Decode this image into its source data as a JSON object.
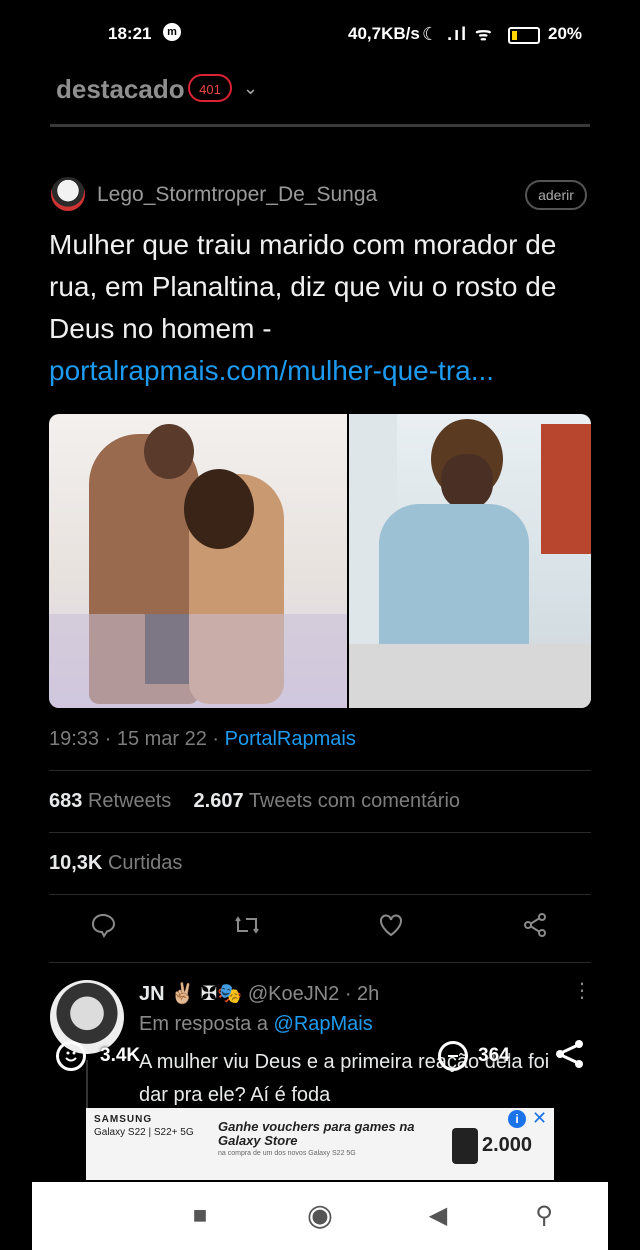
{
  "status_bar": {
    "time": "18:21",
    "net_speed": "40,7KB/s",
    "signal_icons": "☾ .ıl ᯤ",
    "battery": "20%"
  },
  "header": {
    "title": "destacado",
    "badge": "401",
    "chevron": "⌄"
  },
  "post": {
    "author": "Lego_Stormtroper_De_Sunga",
    "follow_label": "aderir",
    "text": "Mulher que traiu marido com morador de rua, em Planaltina, diz que viu o rosto de Deus no homem -",
    "link": "portalrapmais.com/mulher-que-tra...",
    "time": "19:33 · 15 mar 22 · ",
    "source": "PortalRapmais",
    "retweets_count": "683",
    "retweets_label": "Retweets",
    "quotes_count": "2.607",
    "quotes_label": "Tweets com comentário",
    "likes_count": "10,3K",
    "likes_label": "Curtidas"
  },
  "actions": {
    "reply_icon": "comment-icon",
    "retweet_icon": "retweet-icon",
    "like_icon": "heart-icon",
    "share_icon": "share-icon"
  },
  "reply": {
    "name": "JN ✌🏼 ✠🎭",
    "handle": "@KoeJN2 · 2h",
    "more": "⋮",
    "in_reply_prefix": "Em resposta a ",
    "in_reply_handle": "@RapMais",
    "text": "A mulher viu Deus e a primeira reação dela foi dar pra ele? Aí é foda"
  },
  "overlay": {
    "likes": "3.4K",
    "comments": "364"
  },
  "ad": {
    "brand": "SAMSUNG",
    "model": "Galaxy S22 | S22+ 5G",
    "headline": "Ganhe vouchers para games na Galaxy Store",
    "fine_print": "na compra de um dos novos Galaxy S22 5G",
    "price": "2.000",
    "info": "i",
    "close": "✕"
  },
  "nav": {
    "recents": "■",
    "home": "◉",
    "back": "◀",
    "accessibility": "⚲"
  },
  "colors": {
    "background": "#000000",
    "link": "#1d9bf0",
    "badge": "#dd2233",
    "muted": "#7d7d7d"
  }
}
